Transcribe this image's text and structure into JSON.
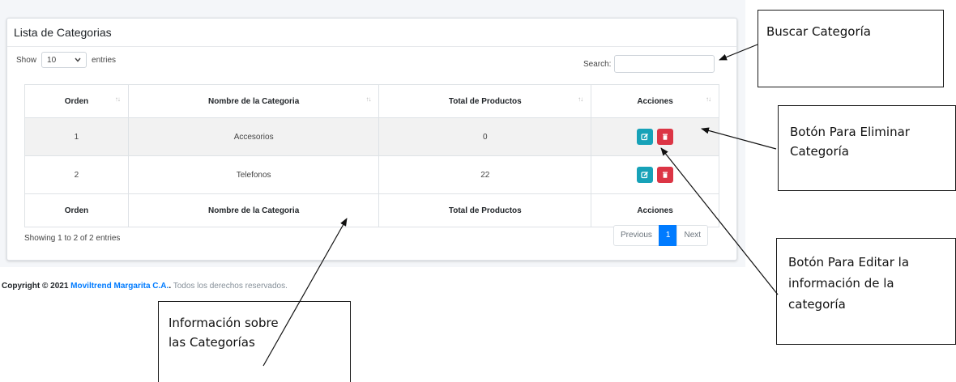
{
  "card": {
    "title": "Lista de Categorias"
  },
  "length": {
    "prefix": "Show",
    "value": "10",
    "suffix": "entries"
  },
  "search": {
    "label": "Search:",
    "value": ""
  },
  "table": {
    "headers": [
      "Orden",
      "Nombre de la Categoria",
      "Total de Productos",
      "Acciones"
    ],
    "rows": [
      {
        "orden": "1",
        "nombre": "Accesorios",
        "total": "0"
      },
      {
        "orden": "2",
        "nombre": "Telefonos",
        "total": "22"
      }
    ],
    "footers": [
      "Orden",
      "Nombre de la Categoria",
      "Total de Productos",
      "Acciones"
    ]
  },
  "info": "Showing 1 to 2 of 2 entries",
  "pagination": {
    "previous": "Previous",
    "page": "1",
    "next": "Next"
  },
  "footer": {
    "copyright": "Copyright © 2021",
    "brand": "Moviltrend Margarita C.A.",
    "rest": "Todos los derechos reservados."
  },
  "colors": {
    "edit": "#17a2b8",
    "delete": "#dc3545",
    "accent": "#007bff"
  },
  "icons": {
    "edit": "edit-icon",
    "delete": "trash-icon",
    "sort": "sort-icon",
    "dropdown": "chevron-down-icon"
  },
  "callouts": {
    "buscar": "Buscar Categoría",
    "eliminar_line1": "Botón Para Eliminar",
    "eliminar_line2": "Categoría",
    "editar_line1": "Botón Para Editar la",
    "editar_line2": "información de la",
    "editar_line3": "categoría",
    "info_line1": "Información sobre",
    "info_line2": "las Categorías"
  }
}
